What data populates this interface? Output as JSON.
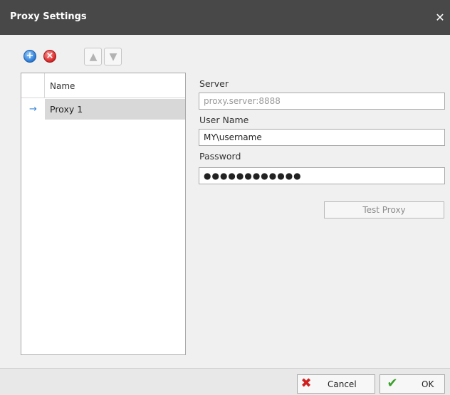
{
  "window": {
    "title": "Proxy Settings",
    "close_glyph": "✕"
  },
  "toolbar": {
    "add_icon": "add-circle-icon",
    "remove_icon": "remove-circle-icon",
    "move_up_icon": "arrow-up-icon",
    "move_down_icon": "arrow-down-icon"
  },
  "grid": {
    "columns": [
      "Name"
    ],
    "rows": [
      {
        "name": "Proxy 1",
        "current": true
      }
    ]
  },
  "form": {
    "server": {
      "label": "Server",
      "value": "",
      "placeholder": "proxy.server:8888"
    },
    "user_name": {
      "label": "User Name",
      "value": "MY\\username"
    },
    "password": {
      "label": "Password",
      "masked_value": "●●●●●●●●●●●●"
    },
    "test_button": "Test Proxy"
  },
  "footer": {
    "cancel_label": "Cancel",
    "ok_label": "OK"
  },
  "colors": {
    "titlebar": "#484848",
    "selected_row": "#d8d8d8",
    "add_icon": "#2f7ed8",
    "remove_icon": "#d92a2a",
    "cancel_icon": "#d01f1f",
    "ok_icon": "#3aa02a"
  }
}
